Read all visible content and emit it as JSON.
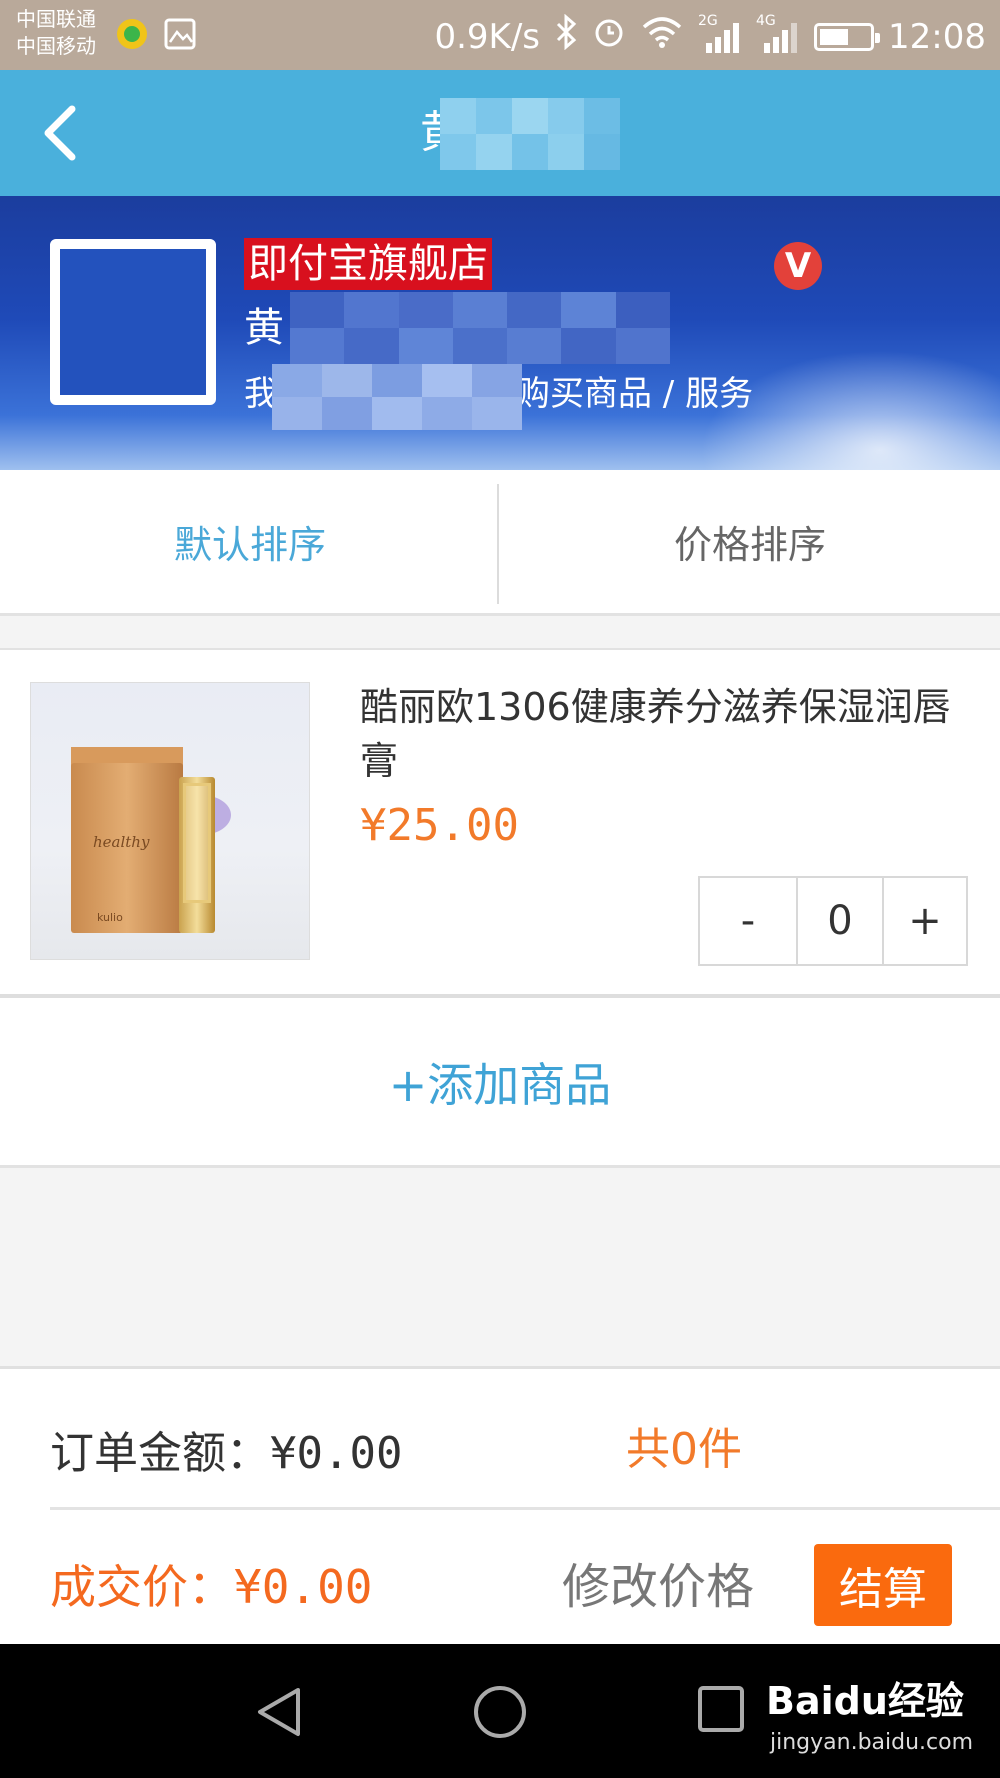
{
  "status_bar": {
    "carrier1": "中国联通",
    "carrier2": "中国移动",
    "net_speed": "0.9K/s",
    "signal1": "2G",
    "signal2": "4G",
    "time": "12:08"
  },
  "header": {
    "title": "黄"
  },
  "store": {
    "badge": "即付宝旗舰店",
    "verified_mark": "V",
    "name": "黄",
    "desc": "我要向商家付款，购买商品 / 服务"
  },
  "sort_tabs": [
    {
      "label": "默认排序",
      "active": true
    },
    {
      "label": "价格排序",
      "active": false
    }
  ],
  "product": {
    "name": "酷丽欧1306健康养分滋养保湿润唇膏",
    "price": "¥25.00",
    "qty": "0",
    "minus": "-",
    "plus": "+",
    "image_text": "healthy",
    "image_brand": "kulio"
  },
  "add_product": "+添加商品",
  "summary": {
    "order_label": "订单金额：",
    "order_amount": "¥0.00",
    "count": "共0件",
    "deal_label": "成交价：",
    "deal_amount": "¥0.00",
    "edit_price": "修改价格",
    "checkout": "结算"
  },
  "watermark": {
    "logo": "Baidu经验",
    "url": "jingyan.baidu.com"
  },
  "colors": {
    "header_blue": "#4ab0dc",
    "accent_orange": "#f27a2a",
    "checkout_orange": "#fa6a0e",
    "active_tab": "#4aa8d8"
  }
}
